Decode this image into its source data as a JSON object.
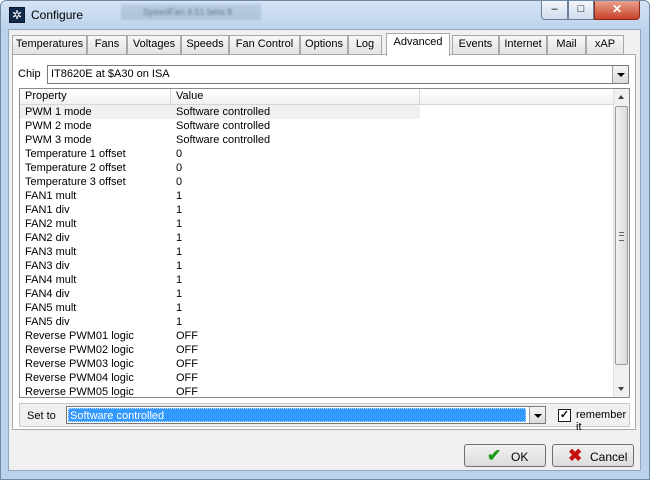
{
  "window": {
    "title": "Configure",
    "background_title": "SpeedFan 4.51 beta 8"
  },
  "tabs": [
    {
      "label": "Temperatures",
      "active": false
    },
    {
      "label": "Fans",
      "active": false
    },
    {
      "label": "Voltages",
      "active": false
    },
    {
      "label": "Speeds",
      "active": false
    },
    {
      "label": "Fan Control",
      "active": false
    },
    {
      "label": "Options",
      "active": false
    },
    {
      "label": "Log",
      "active": false
    },
    {
      "label": "Advanced",
      "active": true
    },
    {
      "label": "Events",
      "active": false
    },
    {
      "label": "Internet",
      "active": false
    },
    {
      "label": "Mail",
      "active": false
    },
    {
      "label": "xAP",
      "active": false
    }
  ],
  "chip": {
    "label": "Chip",
    "value": "IT8620E at $A30 on ISA"
  },
  "table": {
    "columns": [
      "Property",
      "Value"
    ],
    "rows": [
      [
        "PWM 1 mode",
        "Software controlled"
      ],
      [
        "PWM 2 mode",
        "Software controlled"
      ],
      [
        "PWM 3 mode",
        "Software controlled"
      ],
      [
        "Temperature 1 offset",
        "0"
      ],
      [
        "Temperature 2 offset",
        "0"
      ],
      [
        "Temperature 3 offset",
        "0"
      ],
      [
        "FAN1 mult",
        "1"
      ],
      [
        "FAN1 div",
        "1"
      ],
      [
        "FAN2 mult",
        "1"
      ],
      [
        "FAN2 div",
        "1"
      ],
      [
        "FAN3 mult",
        "1"
      ],
      [
        "FAN3 div",
        "1"
      ],
      [
        "FAN4 mult",
        "1"
      ],
      [
        "FAN4 div",
        "1"
      ],
      [
        "FAN5 mult",
        "1"
      ],
      [
        "FAN5 div",
        "1"
      ],
      [
        "Reverse PWM01 logic",
        "OFF"
      ],
      [
        "Reverse PWM02 logic",
        "OFF"
      ],
      [
        "Reverse PWM03 logic",
        "OFF"
      ],
      [
        "Reverse PWM04 logic",
        "OFF"
      ],
      [
        "Reverse PWM05 logic",
        "OFF"
      ]
    ],
    "selected_row": 0
  },
  "set_to": {
    "label": "Set to",
    "value": "Software controlled",
    "remember_label": "remember it",
    "remember_checked": true,
    "check_glyph": "✓"
  },
  "buttons": {
    "ok": "OK",
    "cancel": "Cancel",
    "ok_icon": "✔",
    "cancel_icon": "✖"
  },
  "caption_buttons": {
    "minimize": "–",
    "maximize": "□",
    "close": "✕"
  },
  "app_icon_glyph": "✲"
}
